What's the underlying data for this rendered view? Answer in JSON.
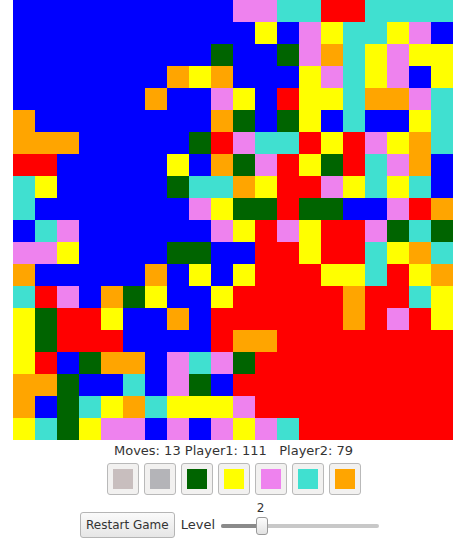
{
  "board": {
    "palette": [
      "#0000ff",
      "#ff0000",
      "#ffff00",
      "#006400",
      "#ee82ee",
      "#40e0d0",
      "#ffa500"
    ],
    "rows": [
      [
        0,
        0,
        0,
        0,
        0,
        0,
        0,
        0,
        0,
        0,
        4,
        4,
        5,
        5,
        1,
        1,
        5,
        5,
        5,
        5
      ],
      [
        0,
        0,
        0,
        0,
        0,
        0,
        0,
        0,
        0,
        0,
        0,
        2,
        0,
        4,
        2,
        5,
        5,
        2,
        4,
        0
      ],
      [
        0,
        0,
        0,
        0,
        0,
        0,
        0,
        0,
        0,
        3,
        0,
        0,
        3,
        4,
        6,
        5,
        2,
        4,
        2,
        2
      ],
      [
        0,
        0,
        0,
        0,
        0,
        0,
        0,
        6,
        2,
        6,
        0,
        0,
        0,
        2,
        4,
        5,
        2,
        4,
        0,
        2
      ],
      [
        0,
        0,
        0,
        0,
        0,
        0,
        6,
        0,
        0,
        4,
        2,
        0,
        1,
        2,
        2,
        5,
        6,
        6,
        4,
        5
      ],
      [
        6,
        0,
        0,
        0,
        0,
        0,
        0,
        0,
        0,
        6,
        3,
        0,
        3,
        2,
        0,
        5,
        0,
        0,
        2,
        5
      ],
      [
        6,
        6,
        6,
        0,
        0,
        0,
        0,
        0,
        3,
        1,
        4,
        5,
        5,
        1,
        2,
        1,
        4,
        2,
        6,
        5
      ],
      [
        1,
        1,
        0,
        0,
        0,
        0,
        0,
        2,
        0,
        6,
        3,
        4,
        1,
        2,
        3,
        1,
        5,
        4,
        6,
        0
      ],
      [
        5,
        2,
        0,
        0,
        0,
        0,
        0,
        3,
        5,
        5,
        6,
        2,
        1,
        1,
        4,
        2,
        5,
        2,
        5,
        0
      ],
      [
        5,
        0,
        0,
        0,
        0,
        0,
        0,
        0,
        4,
        2,
        3,
        3,
        1,
        3,
        3,
        0,
        0,
        4,
        1,
        6
      ],
      [
        0,
        5,
        4,
        0,
        0,
        0,
        0,
        0,
        0,
        4,
        2,
        1,
        4,
        2,
        1,
        1,
        4,
        3,
        5,
        3
      ],
      [
        4,
        4,
        2,
        0,
        0,
        0,
        0,
        3,
        3,
        0,
        0,
        1,
        1,
        2,
        1,
        1,
        5,
        2,
        6,
        5
      ],
      [
        6,
        0,
        0,
        0,
        0,
        0,
        6,
        0,
        2,
        0,
        2,
        1,
        1,
        1,
        2,
        2,
        5,
        1,
        2,
        6
      ],
      [
        5,
        1,
        4,
        0,
        6,
        3,
        2,
        0,
        0,
        2,
        1,
        1,
        1,
        1,
        1,
        6,
        1,
        1,
        5,
        2
      ],
      [
        2,
        3,
        1,
        1,
        2,
        0,
        0,
        6,
        0,
        1,
        1,
        1,
        1,
        1,
        1,
        6,
        1,
        4,
        1,
        2
      ],
      [
        2,
        3,
        1,
        1,
        1,
        0,
        0,
        0,
        0,
        1,
        6,
        6,
        1,
        1,
        1,
        1,
        1,
        1,
        1,
        1
      ],
      [
        2,
        1,
        0,
        3,
        6,
        6,
        0,
        4,
        5,
        4,
        3,
        1,
        1,
        1,
        1,
        1,
        1,
        1,
        1,
        1
      ],
      [
        6,
        6,
        3,
        0,
        0,
        5,
        0,
        4,
        3,
        0,
        1,
        1,
        1,
        1,
        1,
        1,
        1,
        1,
        1,
        1
      ],
      [
        6,
        0,
        3,
        5,
        2,
        6,
        5,
        2,
        2,
        2,
        4,
        1,
        1,
        1,
        1,
        1,
        1,
        1,
        1,
        1
      ],
      [
        2,
        5,
        3,
        2,
        4,
        4,
        0,
        4,
        0,
        4,
        2,
        4,
        5,
        1,
        1,
        1,
        1,
        1,
        1,
        1
      ]
    ]
  },
  "status": "Moves: 13 Player1: 111   Player2: 79",
  "color_buttons": [
    {
      "color": "#c8bebe"
    },
    {
      "color": "#b4b4b8"
    },
    {
      "color": "#006400"
    },
    {
      "color": "#ffff00"
    },
    {
      "color": "#ee82ee"
    },
    {
      "color": "#40e0d0"
    },
    {
      "color": "#ffa500"
    }
  ],
  "restart_button": "Restart Game",
  "level": {
    "label": "Level",
    "reading": "2",
    "level": 0.25
  }
}
